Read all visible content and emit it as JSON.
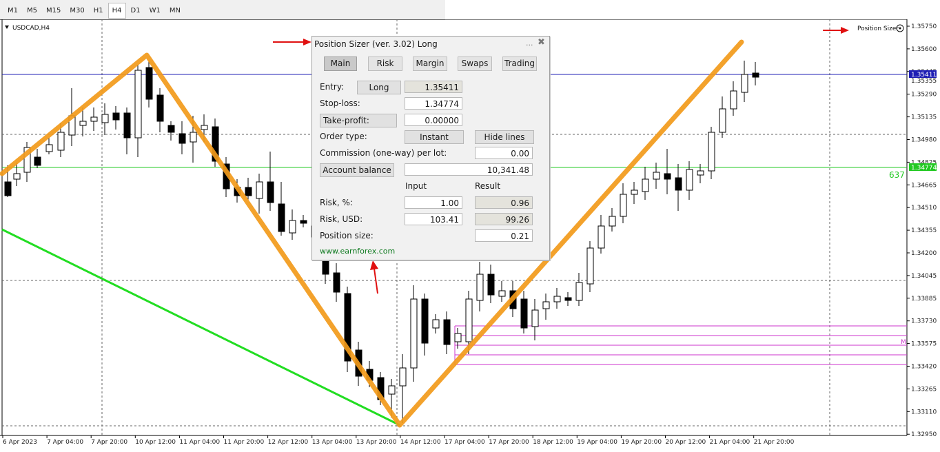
{
  "toolbar": {
    "timeframes": [
      "M1",
      "M5",
      "M15",
      "M30",
      "H1",
      "H4",
      "D1",
      "W1",
      "MN"
    ],
    "active": "H4"
  },
  "chart": {
    "symbol_label": "USDCAD,H4",
    "indicator_label": "Position Sizer",
    "right_marker": "637",
    "right_edge_marker": "M",
    "price_ticks": [
      "1.35750",
      "1.35600",
      "1.35445",
      "1.35290",
      "1.35135",
      "1.34980",
      "1.34825",
      "1.34665",
      "1.34510",
      "1.34355",
      "1.34200",
      "1.34045",
      "1.33885",
      "1.33730",
      "1.33575",
      "1.33420",
      "1.33265",
      "1.33110",
      "1.32950"
    ],
    "time_ticks": [
      "6 Apr 2023",
      "7 Apr 04:00",
      "7 Apr 20:00",
      "10 Apr 12:00",
      "11 Apr 04:00",
      "11 Apr 20:00",
      "12 Apr 12:00",
      "13 Apr 04:00",
      "13 Apr 20:00",
      "14 Apr 12:00",
      "17 Apr 04:00",
      "17 Apr 20:00",
      "18 Apr 12:00",
      "19 Apr 04:00",
      "19 Apr 20:00",
      "20 Apr 12:00",
      "21 Apr 04:00",
      "21 Apr 20:00"
    ],
    "entry_price_tag": "1.35411",
    "entry_price_tag_under": "1.35355",
    "stop_price_tag": "1.34774",
    "colors": {
      "entry_line": "#1f1fb4",
      "stop_line": "#22c922",
      "zigzag": "#f29a1a",
      "trend_line": "#22dd22",
      "magenta": "#cc33cc",
      "annotation": "#e01010"
    }
  },
  "panel": {
    "title": "Position Sizer (ver. 3.02) Long",
    "min_label": "...",
    "close_label": "✖",
    "tabs": [
      "Main",
      "Risk",
      "Margin",
      "Swaps",
      "Trading"
    ],
    "active_tab": "Main",
    "entry_label": "Entry:",
    "direction_button": "Long",
    "entry_value": "1.35411",
    "stop_label": "Stop-loss:",
    "stop_value": "1.34774",
    "tp_button": "Take-profit:",
    "tp_value": "0.00000",
    "order_type_label": "Order type:",
    "order_type_button": "Instant",
    "hide_lines_button": "Hide lines",
    "commission_label": "Commission (one-way) per lot:",
    "commission_value": "0.00",
    "account_balance_button": "Account balance",
    "account_balance_value": "10,341.48",
    "col_input": "Input",
    "col_result": "Result",
    "risk_pct_label": "Risk, %:",
    "risk_pct_input": "1.00",
    "risk_pct_result": "0.96",
    "risk_usd_label": "Risk, USD:",
    "risk_usd_input": "103.41",
    "risk_usd_result": "99.26",
    "position_size_label": "Position size:",
    "position_size_value": "0.21",
    "link": "www.earnforex.com"
  }
}
